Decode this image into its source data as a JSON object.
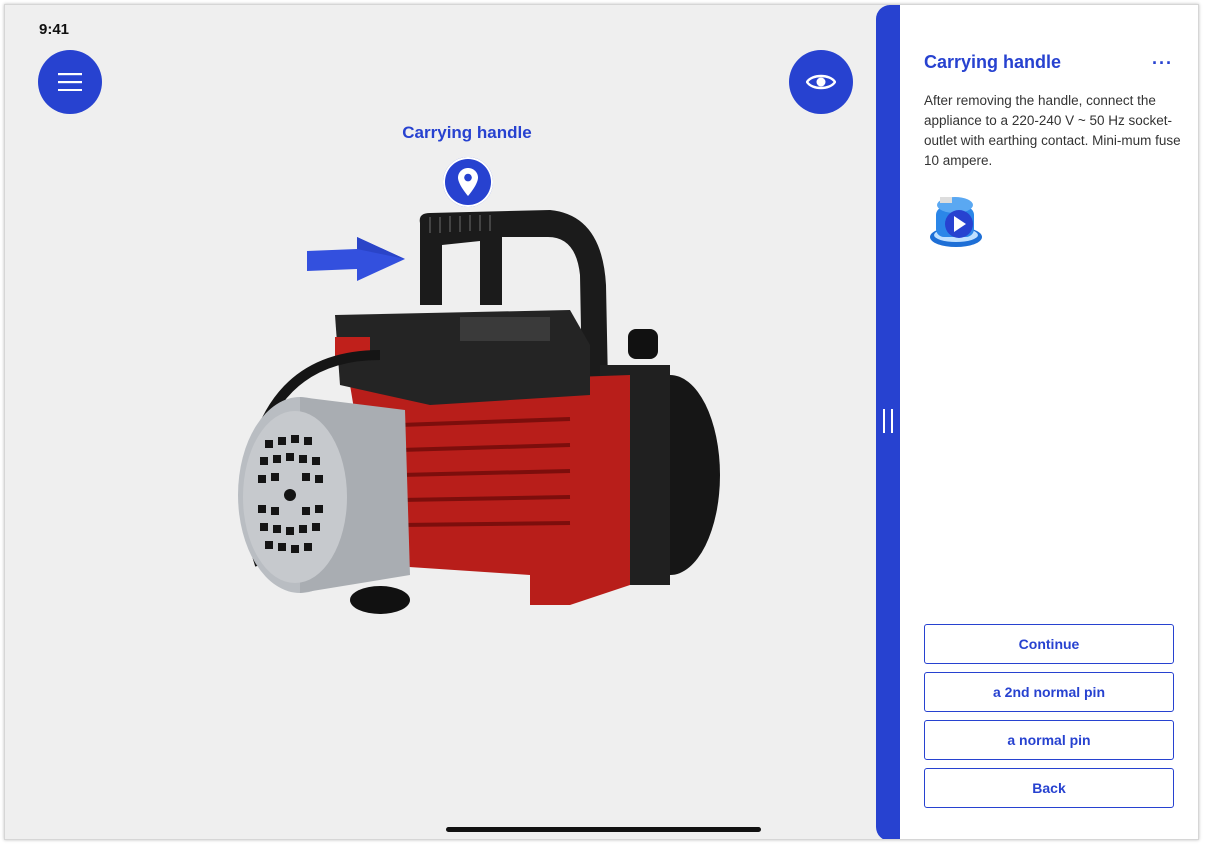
{
  "status": {
    "time": "9:41"
  },
  "toolbar": {
    "menu_icon": "hamburger-menu-icon",
    "eye_icon": "eye-icon"
  },
  "viewer": {
    "pin_label": "Carrying handle",
    "pin_icon": "location-pin-icon",
    "arrow_icon": "arrow-right-icon"
  },
  "panel": {
    "title": "Carrying handle",
    "more_label": "···",
    "description": "After removing the handle, connect the appliance to a 220-240 V ~ 50 Hz socket-outlet with earthing contact. Mini-mum fuse 10 ampere.",
    "video_icon": "play-icon",
    "buttons": {
      "continue": "Continue",
      "second_pin": "a 2nd normal pin",
      "normal_pin": "a normal pin",
      "back": "Back"
    }
  },
  "colors": {
    "accent": "#2742d0",
    "background": "#efefef"
  }
}
